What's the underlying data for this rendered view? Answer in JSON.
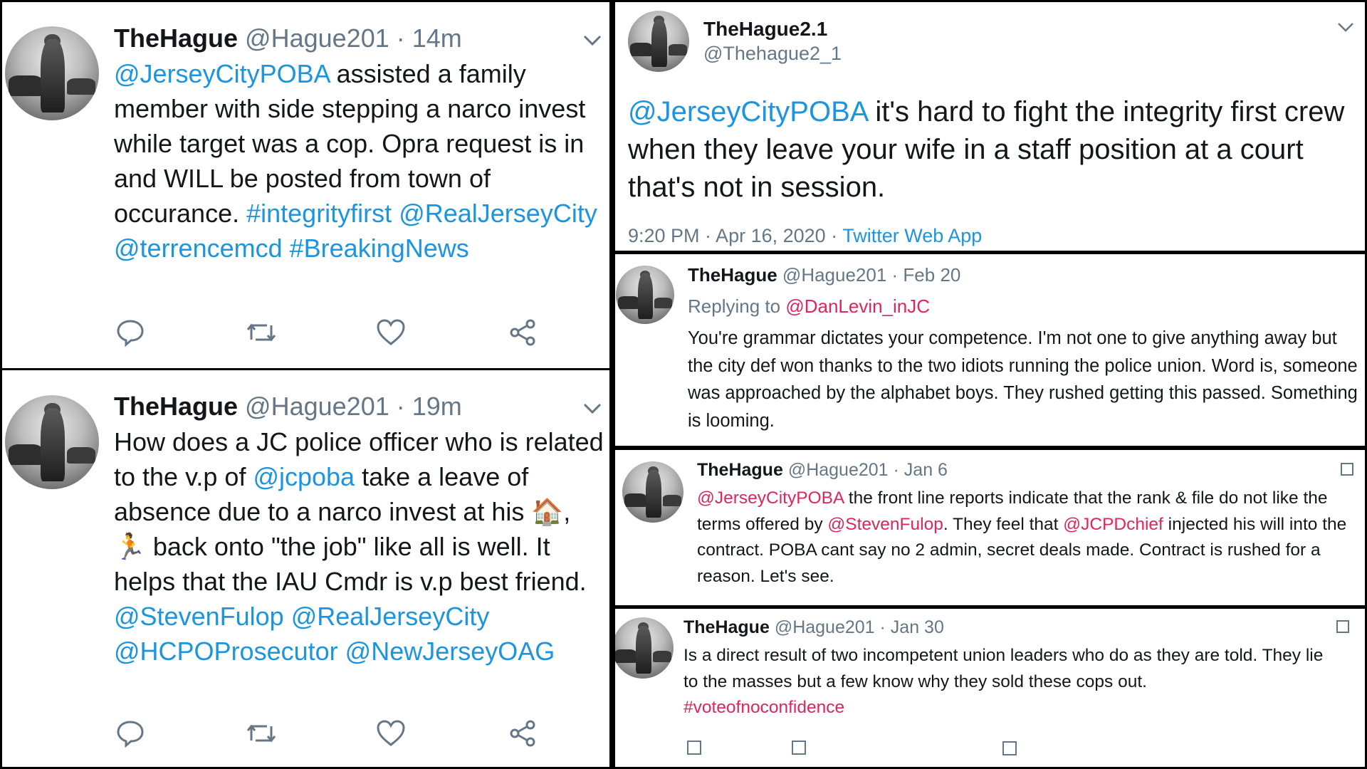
{
  "tweet1": {
    "name": "TheHague",
    "handle": "@Hague201",
    "time": "· 14m",
    "segments": [
      {
        "text": "@JerseyCityPOBA",
        "link": true
      },
      {
        "text": " assisted a family member with side stepping a narco invest while target was a cop. Opra request is in and WILL be posted from town of occurance. ",
        "link": false
      },
      {
        "text": "#integrityfirst",
        "link": true
      },
      {
        "text": " ",
        "link": false
      },
      {
        "text": "@RealJerseyCity",
        "link": true
      },
      {
        "text": " ",
        "link": false
      },
      {
        "text": "@terrencemcd",
        "link": true
      },
      {
        "text": " ",
        "link": false
      },
      {
        "text": "#BreakingNews",
        "link": true
      }
    ]
  },
  "tweet2": {
    "name": "TheHague",
    "handle": "@Hague201",
    "time": "· 19m",
    "segments": [
      {
        "text": "How does a JC police officer who is related to the v.p of ",
        "link": false
      },
      {
        "text": "@jcpoba",
        "link": true
      },
      {
        "text": " take a leave of absence due to a narco invest at his 🏠, 🏃 back onto \"the job\" like all is well. It helps that the IAU Cmdr is v.p best friend. ",
        "link": false
      },
      {
        "text": "@StevenFulop",
        "link": true
      },
      {
        "text": " ",
        "link": false
      },
      {
        "text": "@RealJerseyCity",
        "link": true
      },
      {
        "text": " ",
        "link": false
      },
      {
        "text": "@HCPOProsecutor",
        "link": true
      },
      {
        "text": " ",
        "link": false
      },
      {
        "text": "@NewJerseyOAG",
        "link": true
      }
    ]
  },
  "tweet3": {
    "name": "TheHague2.1",
    "handle": "@Thehague2_1",
    "segments": [
      {
        "text": "@JerseyCityPOBA",
        "link": true
      },
      {
        "text": " it's hard to fight the integrity first crew when they leave your wife in a staff position at a court that's not in session.",
        "link": false
      }
    ],
    "timestamp": "9:20 PM · Apr 16, 2020 · ",
    "source": "Twitter Web App"
  },
  "tweet4": {
    "name": "TheHague",
    "handle": "@Hague201",
    "time": "· Feb 20",
    "replying_label": "Replying to ",
    "replying_to": "@DanLevin_inJC",
    "text": "You're grammar dictates your competence. I'm not one to give anything away but the city def won thanks to the two idiots running the police union. Word is, someone was approached by the alphabet boys. They rushed getting this passed.  Something is looming."
  },
  "tweet5": {
    "name": "TheHague",
    "handle": "@Hague201",
    "time": "· Jan 6",
    "segments": [
      {
        "text": "@JerseyCityPOBA",
        "link": true
      },
      {
        "text": " the front line reports indicate that the rank & file do not like the terms offered by ",
        "link": false
      },
      {
        "text": "@StevenFulop",
        "link": true
      },
      {
        "text": ". They feel that ",
        "link": false
      },
      {
        "text": "@JCPDchief",
        "link": true
      },
      {
        "text": " injected his will into the contract. POBA cant say no 2 admin, secret deals made.  Contract is rushed for a reason. Let's see.",
        "link": false
      }
    ]
  },
  "tweet6": {
    "name": "TheHague",
    "handle": "@Hague201",
    "time": "· Jan 30",
    "text": "Is a direct result of two incompetent union leaders who do as they are told. They lie to the masses but a few know why they sold these cops out.",
    "hashtag": "#voteofnoconfidence"
  },
  "icons": {
    "reply": "reply-icon",
    "retweet": "retweet-icon",
    "like": "heart-icon",
    "share": "share-icon",
    "more": "chevron-down-icon"
  },
  "colors": {
    "link": "#1b95e0",
    "mention_pink": "#e0245e",
    "muted": "#657786",
    "text": "#14171a"
  }
}
